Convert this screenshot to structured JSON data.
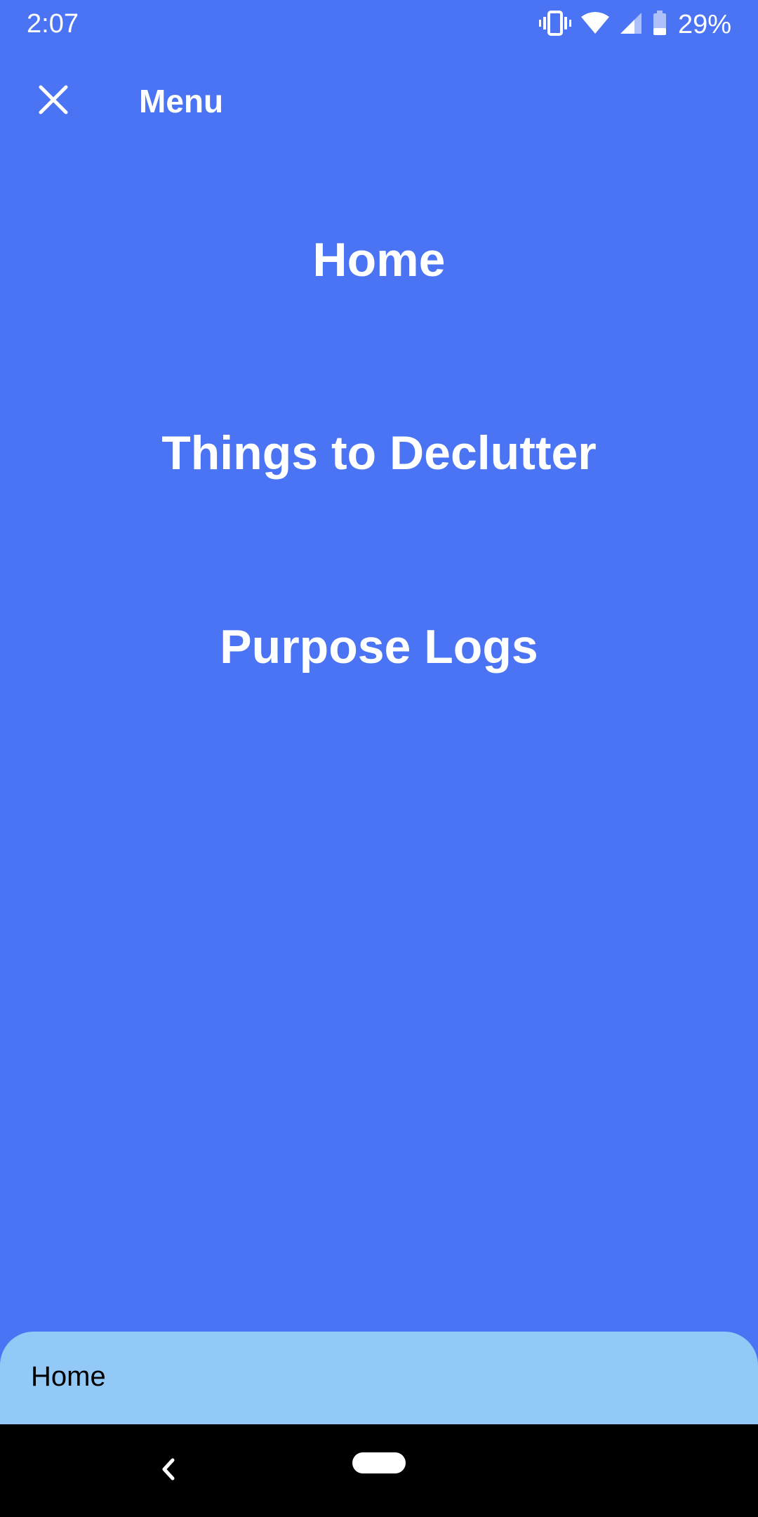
{
  "status_bar": {
    "time": "2:07",
    "battery_percent": "29%",
    "icons": [
      "vibrate-icon",
      "wifi-icon",
      "cell-signal-icon",
      "battery-icon"
    ]
  },
  "toolbar": {
    "title": "Menu",
    "close_icon": "close-icon"
  },
  "menu": {
    "items": [
      {
        "label": "Home"
      },
      {
        "label": "Things to Declutter"
      },
      {
        "label": "Purpose Logs"
      }
    ]
  },
  "bottom_sheet": {
    "label": "Home"
  },
  "nav_bar": {
    "icons": [
      "back-icon",
      "home-pill-icon"
    ]
  },
  "colors": {
    "background": "#4A74F3",
    "bottom_sheet": "#93C9F7",
    "nav_bar": "#000000",
    "text": "#FFFFFF"
  }
}
